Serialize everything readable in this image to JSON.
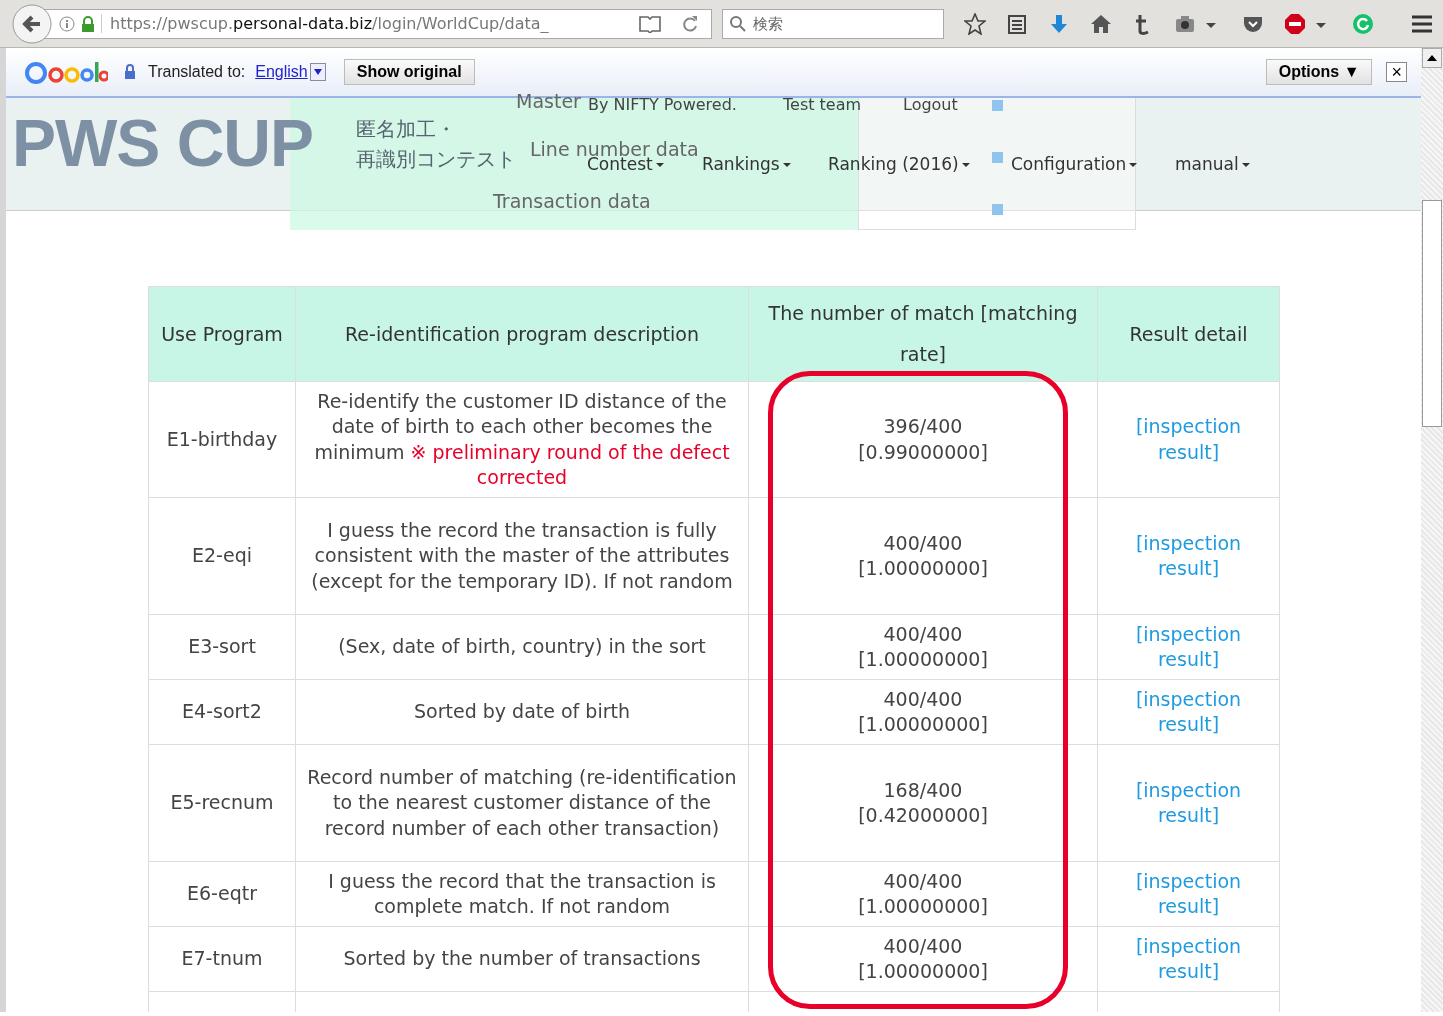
{
  "browser": {
    "url_host": "https://pwscup.",
    "url_domain": "personal-data.biz",
    "url_path": "/login/WorldCup/data_",
    "search": {
      "placeholder": "検索"
    }
  },
  "translate_bar": {
    "label": "Translated to:",
    "language": "English",
    "show_original": "Show original",
    "options": "Options ▼",
    "close": "×"
  },
  "header": {
    "logo": "PWS CUP",
    "subtitle_1": "匿名加工・",
    "subtitle_2": "再識別コンテスト",
    "top_links": [
      "By NIFTY Powered.",
      "Test team",
      "Logout"
    ],
    "nav": [
      "Contest",
      "Rankings",
      "Ranking (2016)",
      "Configuration",
      "manual"
    ],
    "dropdown": [
      "Master",
      "Line number data",
      "Transaction data"
    ]
  },
  "table": {
    "columns": [
      "Use Program",
      "Re-identification program description",
      "The number of match [matching rate]",
      "Result detail"
    ],
    "rows": [
      {
        "program": "E1-birthday",
        "description": "Re-identify the customer ID distance of the date of birth to each other becomes the minimum",
        "note": "※ preliminary round of the defect corrected",
        "match": "396/400",
        "rate": "[0.99000000]",
        "link": "[inspection result]"
      },
      {
        "program": "E2-eqi",
        "description": "I guess the record the transaction is fully consistent with the master of the attributes (except for the temporary ID). If not random",
        "match": "400/400",
        "rate": "[1.00000000]",
        "link": "[inspection result]"
      },
      {
        "program": "E3-sort",
        "description": "(Sex, date of birth, country) in the sort",
        "match": "400/400",
        "rate": "[1.00000000]",
        "link": "[inspection result]"
      },
      {
        "program": "E4-sort2",
        "description": "Sorted by date of birth",
        "match": "400/400",
        "rate": "[1.00000000]",
        "link": "[inspection result]"
      },
      {
        "program": "E5-recnum",
        "description": "Record number of matching (re-identification to the nearest customer distance of the record number of each other transaction)",
        "match": "168/400",
        "rate": "[0.42000000]",
        "link": "[inspection result]"
      },
      {
        "program": "E6-eqtr",
        "description": "I guess the record that the transaction is complete match. If not random",
        "match": "400/400",
        "rate": "[1.00000000]",
        "link": "[inspection result]"
      },
      {
        "program": "E7-tnum",
        "description": "Sorted by the number of transactions",
        "match": "400/400",
        "rate": "[1.00000000]",
        "link": "[inspection result]"
      }
    ]
  }
}
